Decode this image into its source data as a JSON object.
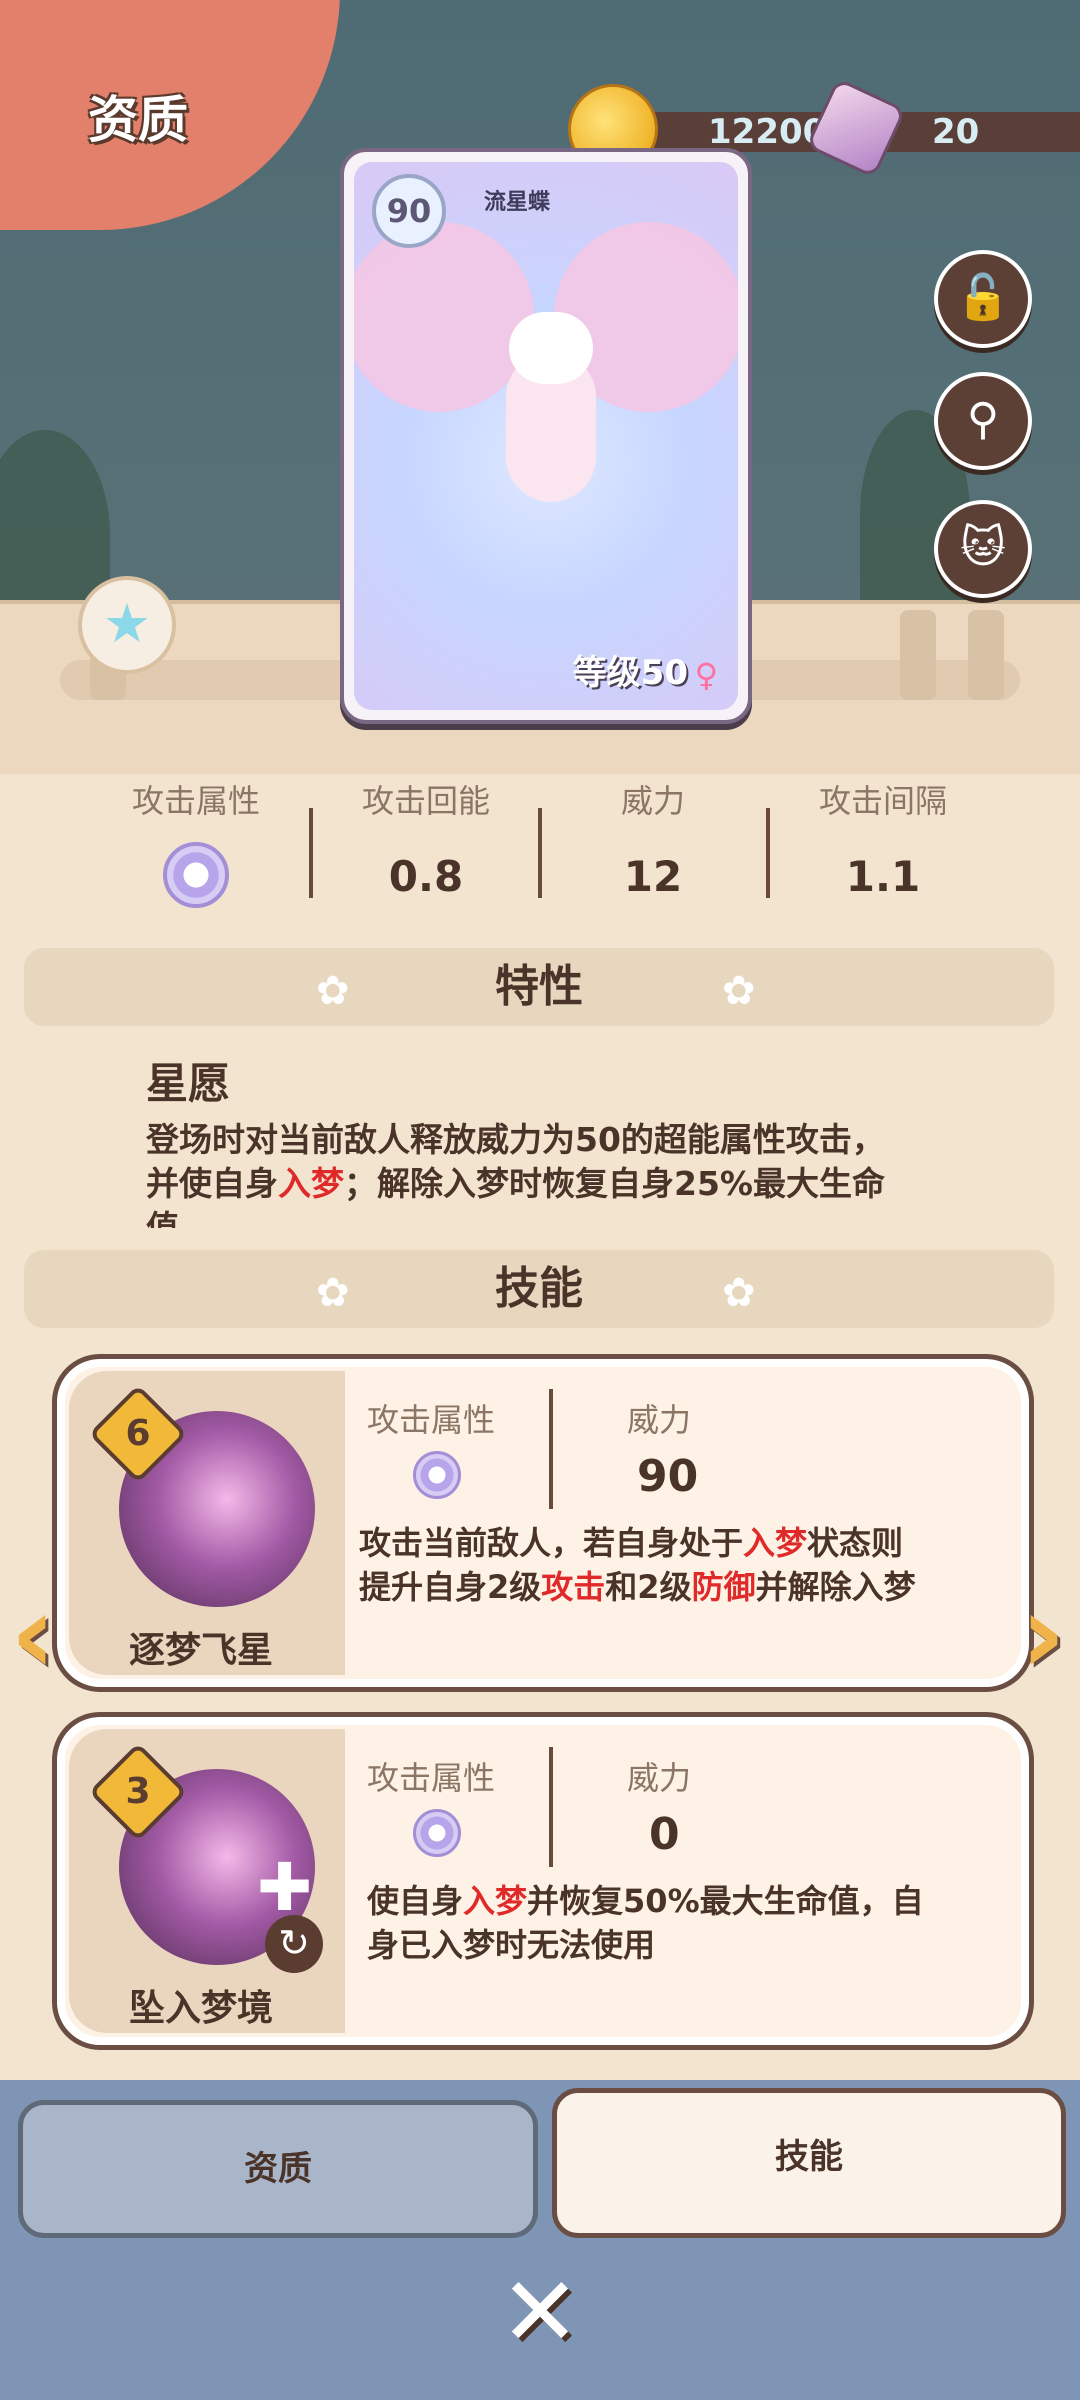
{
  "header": {
    "title": "资质",
    "coins": "122004",
    "gems": "20"
  },
  "card": {
    "name": "流星蝶",
    "cost": "90",
    "level": "等级50",
    "gender": "♀"
  },
  "stats": [
    {
      "label": "攻击属性",
      "value": ""
    },
    {
      "label": "攻击回能",
      "value": "0.8"
    },
    {
      "label": "威力",
      "value": "12"
    },
    {
      "label": "攻击间隔",
      "value": "1.1"
    }
  ],
  "trait": {
    "section_title": "特性",
    "name": "星愿",
    "desc_1": "登场时对当前敌人释放威力为50的超能属性攻击，",
    "desc_2a": "并使自身",
    "desc_2b": "入梦",
    "desc_2c": "；解除入梦时恢复自身25%最大生命",
    "desc_3": "值"
  },
  "skills_section_title": "技能",
  "skills": [
    {
      "name": "逐梦飞星",
      "cost": "6",
      "attr_label": "攻击属性",
      "power_label": "威力",
      "power": "90",
      "desc_1a": "攻击当前敌人，若自身处于",
      "desc_1b": "入梦",
      "desc_1c": "状态则",
      "desc_2a": "提升自身2级",
      "desc_2b": "攻击",
      "desc_2c": "和2级",
      "desc_2d": "防御",
      "desc_2e": "并解除入梦"
    },
    {
      "name": "坠入梦境",
      "cost": "3",
      "attr_label": "攻击属性",
      "power_label": "威力",
      "power": "0",
      "desc_1a": "使自身",
      "desc_1b": "入梦",
      "desc_1c": "并恢复50%最大生命值，自",
      "desc_2": "身已入梦时无法使用"
    }
  ],
  "tabs": {
    "aptitude": "资质",
    "skills": "技能"
  },
  "colors": {
    "highlight_red": "#e02a2a",
    "accent_orange": "#e2806b"
  },
  "icons": {
    "lock": "lock-icon",
    "search": "search-icon",
    "cat_share": "cat-share-icon",
    "star": "star-icon",
    "close": "close-icon",
    "prev": "chevron-left-icon",
    "next": "chevron-right-icon"
  }
}
